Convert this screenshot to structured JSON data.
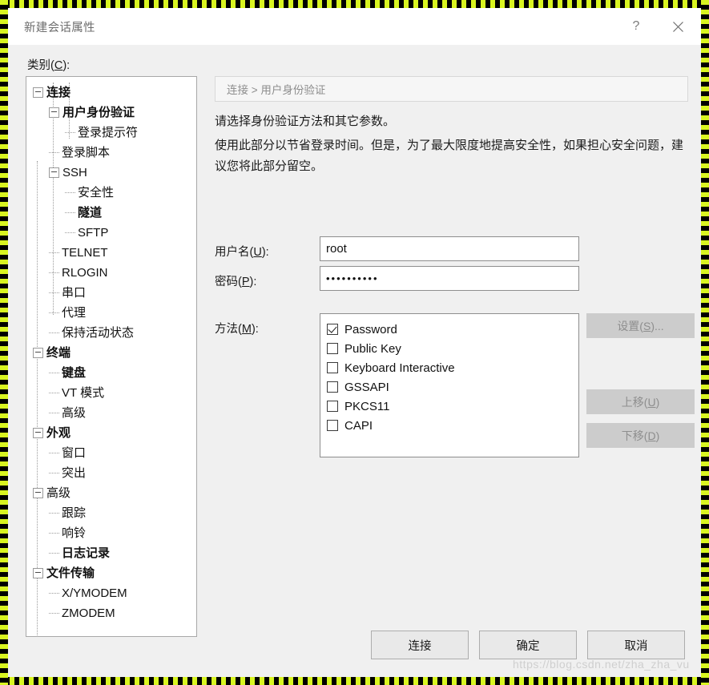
{
  "window": {
    "title": "新建会话属性",
    "help_glyph": "?",
    "close_glyph": "✕"
  },
  "category": {
    "label_prefix": "类别(",
    "label_accel": "C",
    "label_suffix": "):"
  },
  "tree": {
    "items": [
      {
        "label": "连接",
        "level": 0,
        "bold": true,
        "expander": true
      },
      {
        "label": "用户身份验证",
        "level": 1,
        "bold": true,
        "expander": true
      },
      {
        "label": "登录提示符",
        "level": 2,
        "bold": false,
        "expander": false
      },
      {
        "label": "登录脚本",
        "level": 1,
        "bold": false,
        "expander": false
      },
      {
        "label": "SSH",
        "level": 1,
        "bold": false,
        "expander": true
      },
      {
        "label": "安全性",
        "level": 2,
        "bold": false,
        "expander": false
      },
      {
        "label": "隧道",
        "level": 2,
        "bold": true,
        "expander": false
      },
      {
        "label": "SFTP",
        "level": 2,
        "bold": false,
        "expander": false
      },
      {
        "label": "TELNET",
        "level": 1,
        "bold": false,
        "expander": false
      },
      {
        "label": "RLOGIN",
        "level": 1,
        "bold": false,
        "expander": false
      },
      {
        "label": "串口",
        "level": 1,
        "bold": false,
        "expander": false
      },
      {
        "label": "代理",
        "level": 1,
        "bold": false,
        "expander": false
      },
      {
        "label": "保持活动状态",
        "level": 1,
        "bold": false,
        "expander": false
      },
      {
        "label": "终端",
        "level": 0,
        "bold": true,
        "expander": true
      },
      {
        "label": "键盘",
        "level": 1,
        "bold": true,
        "expander": false
      },
      {
        "label": "VT 模式",
        "level": 1,
        "bold": false,
        "expander": false
      },
      {
        "label": "高级",
        "level": 1,
        "bold": false,
        "expander": false
      },
      {
        "label": "外观",
        "level": 0,
        "bold": true,
        "expander": true
      },
      {
        "label": "窗口",
        "level": 1,
        "bold": false,
        "expander": false
      },
      {
        "label": "突出",
        "level": 1,
        "bold": false,
        "expander": false
      },
      {
        "label": "高级",
        "level": 0,
        "bold": false,
        "expander": true
      },
      {
        "label": "跟踪",
        "level": 1,
        "bold": false,
        "expander": false
      },
      {
        "label": "响铃",
        "level": 1,
        "bold": false,
        "expander": false
      },
      {
        "label": "日志记录",
        "level": 1,
        "bold": true,
        "expander": false
      },
      {
        "label": "文件传输",
        "level": 0,
        "bold": true,
        "expander": true
      },
      {
        "label": "X/YMODEM",
        "level": 1,
        "bold": false,
        "expander": false
      },
      {
        "label": "ZMODEM",
        "level": 1,
        "bold": false,
        "expander": false
      }
    ]
  },
  "pane": {
    "breadcrumb": "连接 > 用户身份验证",
    "description_1": "请选择身份验证方法和其它参数。",
    "description_2": "使用此部分以节省登录时间。但是，为了最大限度地提高安全性，如果担心安全问题，建议您将此部分留空。",
    "username_label_prefix": "用户名(",
    "username_label_accel": "U",
    "username_label_suffix": "):",
    "username_value": "root",
    "password_label_prefix": "密码(",
    "password_label_accel": "P",
    "password_label_suffix": "):",
    "password_value": "••••••••••",
    "method_label_prefix": "方法(",
    "method_label_accel": "M",
    "method_label_suffix": "):",
    "methods": [
      {
        "label": "Password",
        "checked": true
      },
      {
        "label": "Public Key",
        "checked": false
      },
      {
        "label": "Keyboard Interactive",
        "checked": false
      },
      {
        "label": "GSSAPI",
        "checked": false
      },
      {
        "label": "PKCS11",
        "checked": false
      },
      {
        "label": "CAPI",
        "checked": false
      }
    ],
    "side_buttons": [
      {
        "prefix": "设置(",
        "accel": "S",
        "suffix": ")...",
        "enabled": false
      },
      {
        "prefix": "上移(",
        "accel": "U",
        "suffix": ")",
        "enabled": false
      },
      {
        "prefix": "下移(",
        "accel": "D",
        "suffix": ")",
        "enabled": false
      }
    ]
  },
  "footer": {
    "connect_label": "连接",
    "ok_label": "确定",
    "cancel_label": "取消"
  },
  "watermark": "https://blog.csdn.net/zha_zha_vu",
  "colors": {
    "hazard_yellow": "#d9f521",
    "hazard_black": "#000000",
    "dialog_bg": "#f0f0f0",
    "titlebar_bg": "#ffffff",
    "field_border": "#8e8e8e",
    "disabled_button_bg": "#cccccc",
    "button_bg": "#e9e9e9"
  }
}
